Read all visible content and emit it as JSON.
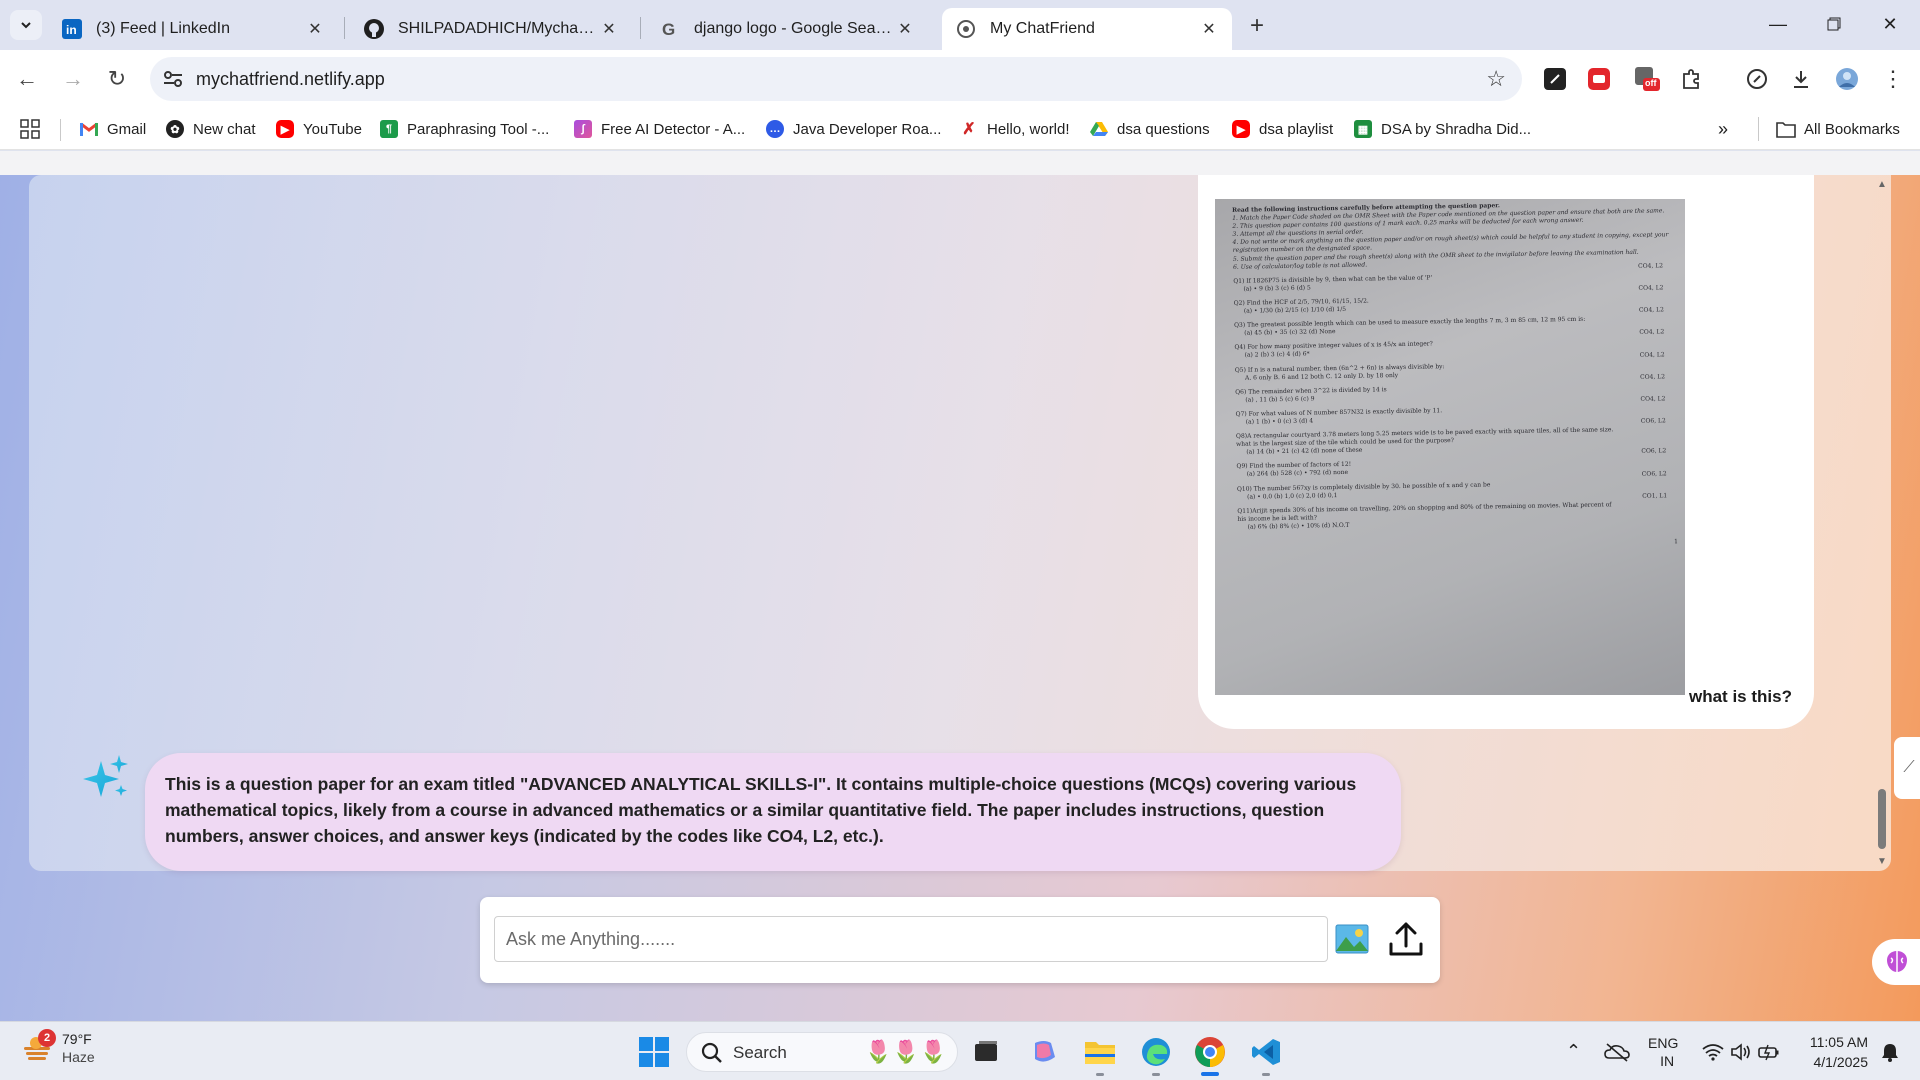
{
  "browser": {
    "tabs": [
      {
        "title": "(3) Feed | LinkedIn",
        "icon": "linkedin-icon"
      },
      {
        "title": "SHILPADADHICH/MychatBot: I",
        "icon": "github-icon"
      },
      {
        "title": "django logo - Google Search",
        "icon": "google-icon"
      },
      {
        "title": "My ChatFriend",
        "icon": "globe-icon",
        "active": true
      }
    ],
    "url": "mychatfriend.netlify.app",
    "extension_badge": "off",
    "bookmarks": [
      {
        "label": "Gmail",
        "icon": "gmail-icon"
      },
      {
        "label": "New chat",
        "icon": "openai-icon"
      },
      {
        "label": "YouTube",
        "icon": "youtube-icon"
      },
      {
        "label": "Paraphrasing Tool -...",
        "icon": "paraphrasing-icon"
      },
      {
        "label": "Free AI Detector - A...",
        "icon": "ai-detector-icon"
      },
      {
        "label": "Java Developer Roa...",
        "icon": "chat-bubble-icon"
      },
      {
        "label": "Hello, world!",
        "icon": "figure-icon"
      },
      {
        "label": "dsa questions",
        "icon": "drive-icon"
      },
      {
        "label": "dsa playlist",
        "icon": "youtube-icon"
      },
      {
        "label": "DSA by Shradha Did...",
        "icon": "sheets-icon"
      }
    ],
    "all_bookmarks": "All Bookmarks"
  },
  "chat": {
    "user_message": "what is this?",
    "exam_image": {
      "instructions_heading": "Read the following instructions carefully before attempting the question paper.",
      "instructions": [
        "1. Match the Paper Code shaded on the OMR Sheet with the Paper code mentioned on the question paper and ensure that both are the same.",
        "2. This question paper contains 100 questions of 1 mark each. 0.25 marks will be deducted for each wrong answer.",
        "3. Attempt all the questions in serial order.",
        "4. Do not write or mark anything on the question paper and/or on rough sheet(s) which could be helpful to any student in copying, except your registration number on the designated space.",
        "5. Submit the question paper and the rough sheet(s) along with the OMR sheet to the invigilator before leaving the examination hall.",
        "6. Use of calculator/log table is not allowed."
      ],
      "questions": [
        {
          "q": "Q1) If 1826P75 is divisible by 9, then what can be the value of 'P'",
          "opts": "(a)  • 9   (b)   3   (c)   6   (d)   5",
          "co": "CO4, L2"
        },
        {
          "q": "Q2) Find the HCF of 2/5, 79/10, 61/15, 15/2.",
          "opts": "(a)  • 1/30   (b)   2/15   (c)   1/10   (d)   1/5",
          "co": "CO4, L2"
        },
        {
          "q": "Q3) The greatest possible length which can be used to measure exactly the lengths 7 m, 3 m 85 cm, 12 m 95 cm is:",
          "opts": "(a)   45   (b)  • 35   (c)   32   (d)   None",
          "co": "CO4, L2"
        },
        {
          "q": "Q4) For how many positive integer values of x is 45/x  an integer?",
          "opts": "(a)   2   (b)   3   (c)   4   (d)   6*",
          "co": "CO4, L2"
        },
        {
          "q": "Q5)    If n is a natural number, then (6n^2 + 6n) is always divisible by:",
          "opts": "A.   6 only B.   6 and 12 both C.   12 only D.   by 18 only",
          "co": "CO4, L2"
        },
        {
          "q": "Q6) The remainder when 3^22 is divided by 14 is",
          "opts": "(a)  , 11  (b)   5   (c)   6   (c)   9",
          "co": "CO4, L2"
        },
        {
          "q": "Q7) For what values of N number 857N32 is exactly divisible by 11.",
          "opts": "(a)   1   (b)  • 0   (c)   3   (d)   4",
          "co": "CO4, L2"
        },
        {
          "q": "Q8)A rectangular courtyard 3.78 meters long 5.25 meters wide is to be paved exactly with square tiles, all of the same size. what is the largest size of the tile which could be used for the purpose?",
          "opts": "(a)   14   (b)  • 21   (c)   42   (d)   none of these",
          "co": "CO6, L2"
        },
        {
          "q": "Q9) Find the number of factors of 12!",
          "opts": "(a)   264   (b)   528   (c)  • 792   (d)   none",
          "co": "CO6, L2"
        },
        {
          "q": "Q10) The number 567xy is completely divisible by 30. he possible of x and y can be",
          "opts": "(a)  • 0,0   (b)   1,0   (c)   2,0   (d)   0,1",
          "co": "CO6, L2"
        },
        {
          "q": "Q11)Arijit spends 30% of his income on travelling, 20% on shopping and 80% of the remaining on movies. What percent of his income he is left with?",
          "opts": "(a)   6%  (b)   8%  (c)  • 10%  (d)   N.O.T",
          "co": "CO1, L1"
        }
      ],
      "page_number": "1"
    },
    "bot_message": "This is a question paper for an exam titled \"ADVANCED ANALYTICAL SKILLS-I\". It contains multiple-choice questions (MCQs) covering various mathematical topics, likely from a course in advanced mathematics or a similar quantitative field. The paper includes instructions, question numbers, answer choices, and answer keys (indicated by the codes like CO4, L2, etc.).",
    "input_placeholder": "Ask me Anything......."
  },
  "taskbar": {
    "weather_badge": "2",
    "temperature": "79°F",
    "condition": "Haze",
    "search_label": "Search",
    "language_line1": "ENG",
    "language_line2": "IN",
    "time": "11:05 AM",
    "date": "4/1/2025"
  }
}
